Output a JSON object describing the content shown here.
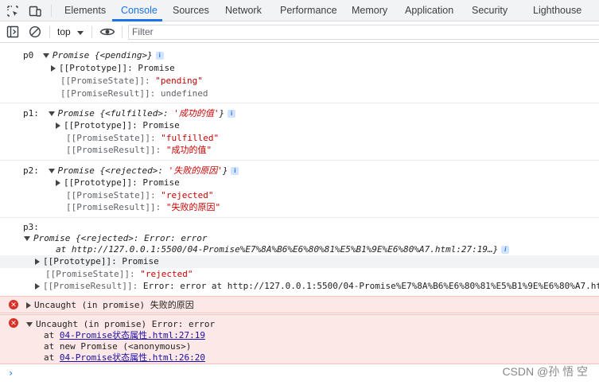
{
  "tabs": [
    "Elements",
    "Console",
    "Sources",
    "Network",
    "Performance",
    "Memory",
    "Application",
    "Security",
    "Lighthouse"
  ],
  "toolbar": {
    "context": "top",
    "filter_placeholder": "Filter"
  },
  "p0": {
    "label": "p0",
    "summary": "Promise {<pending>}",
    "proto": "[[Prototype]]: Promise",
    "state_key": "[[PromiseState]]:",
    "state_val": "\"pending\"",
    "result_key": "[[PromiseResult]]:",
    "result_val": "undefined"
  },
  "p1": {
    "label": "p1:",
    "summary_a": "Promise {<fulfilled>: ",
    "summary_b": "'成功的值'",
    "summary_c": "}",
    "proto": "[[Prototype]]: Promise",
    "state_key": "[[PromiseState]]:",
    "state_val": "\"fulfilled\"",
    "result_key": "[[PromiseResult]]:",
    "result_val": "\"成功的值\""
  },
  "p2": {
    "label": "p2:",
    "summary_a": "Promise {<rejected>: ",
    "summary_b": "'失败的原因'",
    "summary_c": "}",
    "proto": "[[Prototype]]: Promise",
    "state_key": "[[PromiseState]]:",
    "state_val": "\"rejected\"",
    "result_key": "[[PromiseResult]]:",
    "result_val": "\"失败的原因\""
  },
  "p3": {
    "label": "p3:",
    "summary_1": "Promise {<rejected>: Error: error",
    "summary_2": "at http://127.0.0.1:5500/04-Promise%E7%8A%B6%E6%80%81%E5%B1%9E%E6%80%A7.html:27:19…}",
    "proto": "[[Prototype]]: Promise",
    "state_key": "[[PromiseState]]:",
    "state_val": "\"rejected\"",
    "result_key": "[[PromiseResult]]:",
    "result_val": "Error: error at http://127.0.0.1:5500/04-Promise%E7%8A%B6%E6%80%81%E5%B1%9E%E6%80%A7.ht"
  },
  "err1": {
    "text": "Uncaught (in promise) 失败的原因"
  },
  "err2": {
    "text": "Uncaught (in promise) Error: error",
    "at1_pre": "at ",
    "at1_link": "04-Promise状态属性.html:27:19",
    "at2": "at new Promise (<anonymous>)",
    "at3_pre": "at ",
    "at3_link": "04-Promise状态属性.html:26:20"
  },
  "prompt": "›",
  "watermark": "CSDN @孙 悟 空",
  "colors": {
    "accent": "#1a73e8",
    "error": "#d93025",
    "string": "#c80000",
    "key": "#8e3aa1"
  }
}
